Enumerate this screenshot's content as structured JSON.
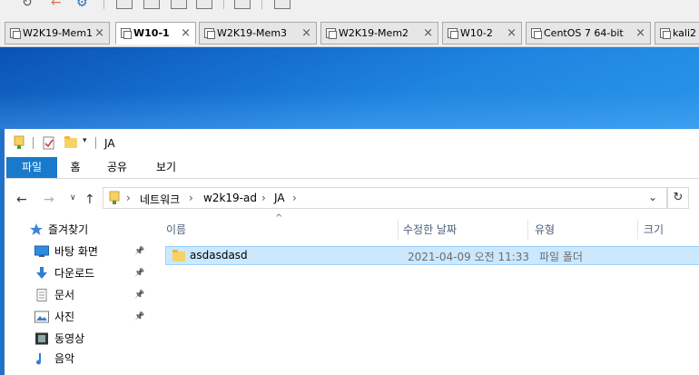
{
  "vmware": {
    "tabs": [
      {
        "label": "W2K19-Mem1",
        "active": false
      },
      {
        "label": "W10-1",
        "active": true
      },
      {
        "label": "W2K19-Mem3",
        "active": false
      },
      {
        "label": "W2K19-Mem2",
        "active": false
      },
      {
        "label": "W10-2",
        "active": false
      },
      {
        "label": "CentOS 7 64-bit",
        "active": false
      },
      {
        "label": "kali2",
        "active": false
      }
    ],
    "close_glyph": "×"
  },
  "explorer": {
    "title": "JA",
    "ribbon_tabs": [
      "파일",
      "홈",
      "공유",
      "보기"
    ],
    "breadcrumb": [
      "네트워크",
      "w2k19-ad",
      "JA"
    ],
    "breadcrumb_separator": "›",
    "navigation": [
      {
        "label": "즐겨찾기",
        "icon": "star-icon",
        "pinned": false
      },
      {
        "label": "바탕 화면",
        "icon": "desktop-icon",
        "pinned": true
      },
      {
        "label": "다운로드",
        "icon": "download-icon",
        "pinned": true
      },
      {
        "label": "문서",
        "icon": "document-icon",
        "pinned": true
      },
      {
        "label": "사진",
        "icon": "pictures-icon",
        "pinned": true
      },
      {
        "label": "동영상",
        "icon": "video-icon",
        "pinned": false
      },
      {
        "label": "음악",
        "icon": "music-icon",
        "pinned": false
      }
    ],
    "columns": [
      "이름",
      "수정한 날짜",
      "유형",
      "크기"
    ],
    "files": [
      {
        "name": "asdasdasd",
        "modified": "2021-04-09 오전 11:33",
        "type": "파일 폴더",
        "size": "",
        "selected": true
      }
    ]
  },
  "colors": {
    "accent": "#1979ca",
    "selection": "#cce8ff",
    "desktop": "#1670d0"
  }
}
